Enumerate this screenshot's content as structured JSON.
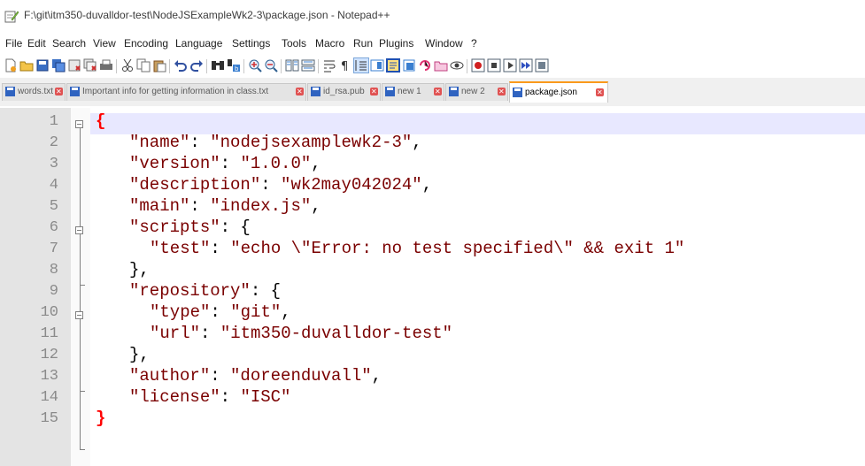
{
  "window": {
    "title": "F:\\git\\itm350-duvalldor-test\\NodeJSExampleWk2-3\\package.json - Notepad++",
    "app_icon": "notepad-plus-plus-icon"
  },
  "menu": [
    "File",
    "Edit",
    "Search",
    "View",
    "Encoding",
    "Language",
    "Settings",
    "Tools",
    "Macro",
    "Run",
    "Plugins",
    "Window",
    "?"
  ],
  "toolbar_icons": [
    "new-file-icon",
    "open-file-icon",
    "save-icon",
    "save-all-icon",
    "close-icon",
    "close-all-icon",
    "print-icon",
    "cut-icon",
    "copy-icon",
    "paste-icon",
    "undo-icon",
    "redo-icon",
    "find-icon",
    "replace-icon",
    "zoom-in-icon",
    "zoom-out-icon",
    "sync-vertical-icon",
    "sync-horizontal-icon",
    "word-wrap-icon",
    "show-all-chars-icon",
    "indent-guide-icon",
    "doc-map-icon",
    "function-list-icon",
    "folder-workspace-icon",
    "monitoring-icon",
    "record-macro-icon",
    "stop-record-icon",
    "play-macro-icon",
    "run-macro-multiple-icon",
    "save-macro-icon"
  ],
  "tabs": [
    {
      "label": "words.txt",
      "active": false
    },
    {
      "label": "Important info for getting information in class.txt",
      "active": false
    },
    {
      "label": "id_rsa.pub",
      "active": false
    },
    {
      "label": "new 1",
      "active": false
    },
    {
      "label": "new 2",
      "active": false
    },
    {
      "label": "package.json",
      "active": true
    }
  ],
  "editor": {
    "line_numbers": [
      "1",
      "2",
      "3",
      "4",
      "5",
      "6",
      "7",
      "8",
      "9",
      "10",
      "11",
      "12",
      "13",
      "14",
      "15"
    ],
    "lines": {
      "l1": {
        "brace": "{"
      },
      "l2": {
        "key": "\"name\"",
        "sep": ": ",
        "val": "\"nodejsexamplewk2-3\"",
        "tail": ","
      },
      "l3": {
        "key": "\"version\"",
        "sep": ": ",
        "val": "\"1.0.0\"",
        "tail": ","
      },
      "l4": {
        "key": "\"description\"",
        "sep": ": ",
        "val": "\"wk2may042024\"",
        "tail": ","
      },
      "l5": {
        "key": "\"main\"",
        "sep": ": ",
        "val": "\"index.js\"",
        "tail": ","
      },
      "l6": {
        "key": "\"scripts\"",
        "sep": ": {"
      },
      "l7": {
        "key": "\"test\"",
        "sep": ": ",
        "val": "\"echo \\\"Error: no test specified\\\" && exit 1\""
      },
      "l8": {
        "text": "},"
      },
      "l9": {
        "key": "\"repository\"",
        "sep": ": {"
      },
      "l10": {
        "key": "\"type\"",
        "sep": ": ",
        "val": "\"git\"",
        "tail": ","
      },
      "l11": {
        "key": "\"url\"",
        "sep": ": ",
        "val": "\"itm350-duvalldor-test\""
      },
      "l12": {
        "text": "},"
      },
      "l13": {
        "key": "\"author\"",
        "sep": ": ",
        "val": "\"doreenduvall\"",
        "tail": ","
      },
      "l14": {
        "key": "\"license\"",
        "sep": ": ",
        "val": "\"ISC\""
      },
      "l15": {
        "brace": "}"
      }
    }
  },
  "colors": {
    "accent_tab": "#fa9a1c",
    "string": "#7a0000",
    "brace_match": "#ff0000",
    "current_line": "#e8e8ff"
  }
}
